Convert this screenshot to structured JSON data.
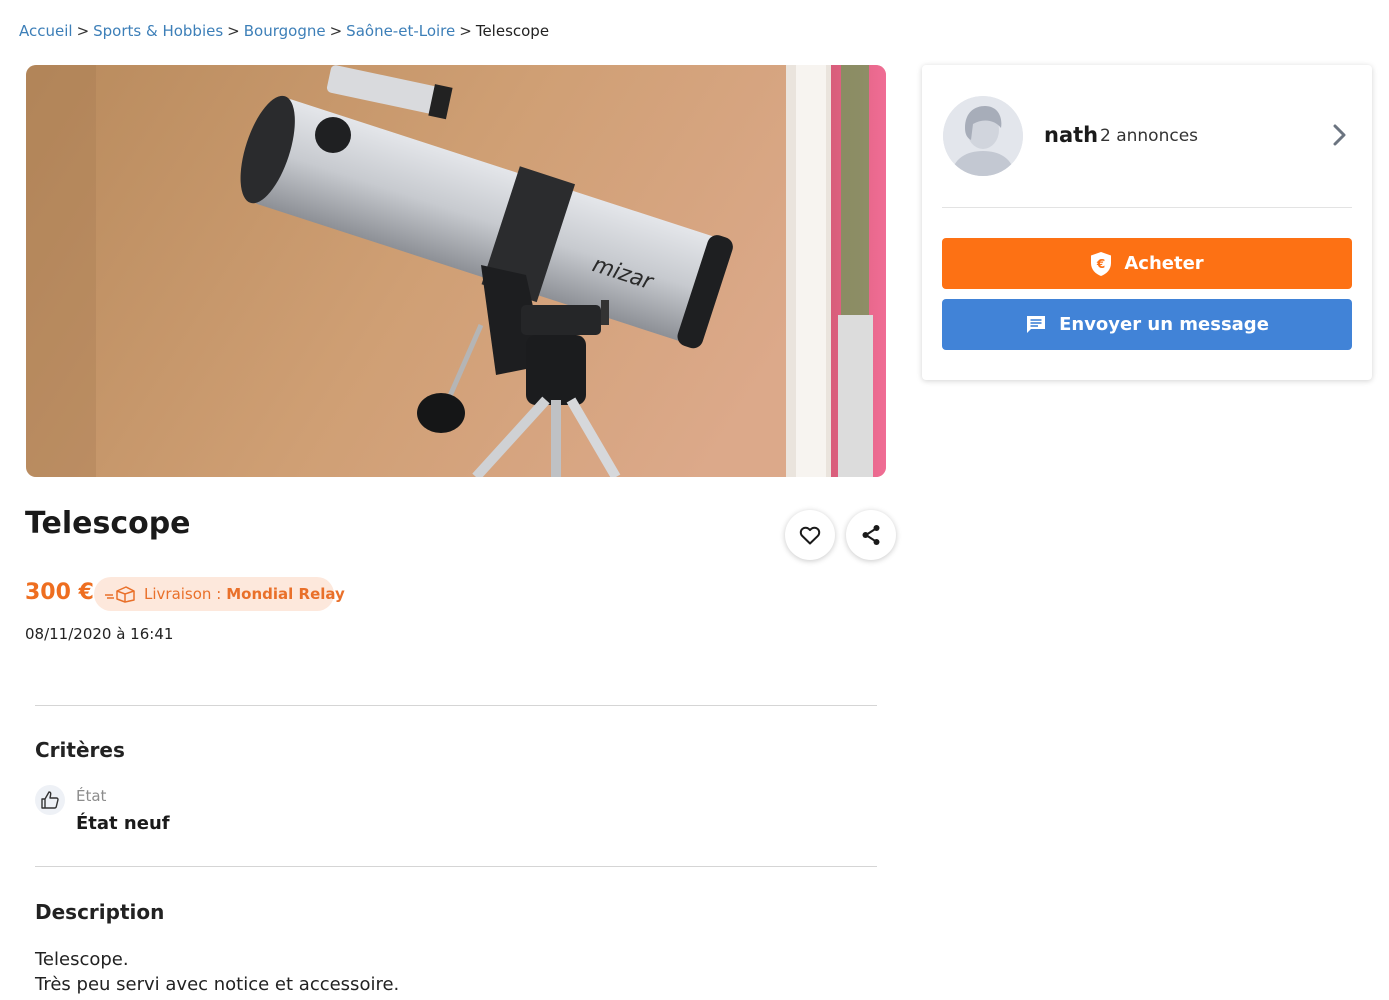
{
  "breadcrumb": {
    "items": [
      "Accueil",
      "Sports & Hobbies",
      "Bourgogne",
      "Saône-et-Loire"
    ],
    "separator": ">",
    "current": "Telescope"
  },
  "listing": {
    "title": "Telescope",
    "price": "300 €",
    "delivery_label": "Livraison :",
    "delivery_carrier": "Mondial Relay",
    "date": "08/11/2020 à 16:41",
    "photo_brand_text": "mizar"
  },
  "criteria": {
    "heading": "Critères",
    "label": "État",
    "value": "État neuf"
  },
  "description": {
    "heading": "Description",
    "line1": "Telescope.",
    "line2": "Très peu servi avec notice et accessoire."
  },
  "seller": {
    "name": "nath",
    "ads_count": "2 annonces",
    "buy_label": "Acheter",
    "message_label": "Envoyer un message"
  },
  "colors": {
    "accent_orange": "#fd7114",
    "accent_blue": "#4183d7",
    "link": "#3d7fb8"
  },
  "icons": [
    "heart-icon",
    "share-icon",
    "delivery-box-icon",
    "thumbs-up-icon",
    "chevron-right-icon",
    "euro-shield-icon",
    "message-icon"
  ]
}
